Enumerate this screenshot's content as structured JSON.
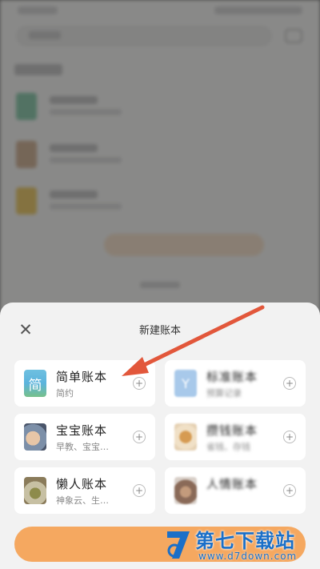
{
  "sheet": {
    "title": "新建账本",
    "close_icon": "close-icon"
  },
  "templates": [
    {
      "name": "简单账本",
      "desc": "简约",
      "thumb_text": "简"
    },
    {
      "name": "宝宝账本",
      "desc": "早教、宝宝…"
    },
    {
      "name": "懒人账本",
      "desc": "神象云、生…"
    },
    {
      "name": "标准账本",
      "desc": "预算记录",
      "thumb_text": "Y"
    },
    {
      "name": "攒钱账本",
      "desc": "省钱、存钱"
    },
    {
      "name": "人情账本",
      "desc": ""
    }
  ],
  "add_symbol": "+",
  "colors": {
    "accent": "#f5a860",
    "arrow": "#e2573b",
    "watermark": "#1a6fc8"
  },
  "watermark": {
    "title": "第七下载站",
    "url": "www.d7down.com"
  }
}
